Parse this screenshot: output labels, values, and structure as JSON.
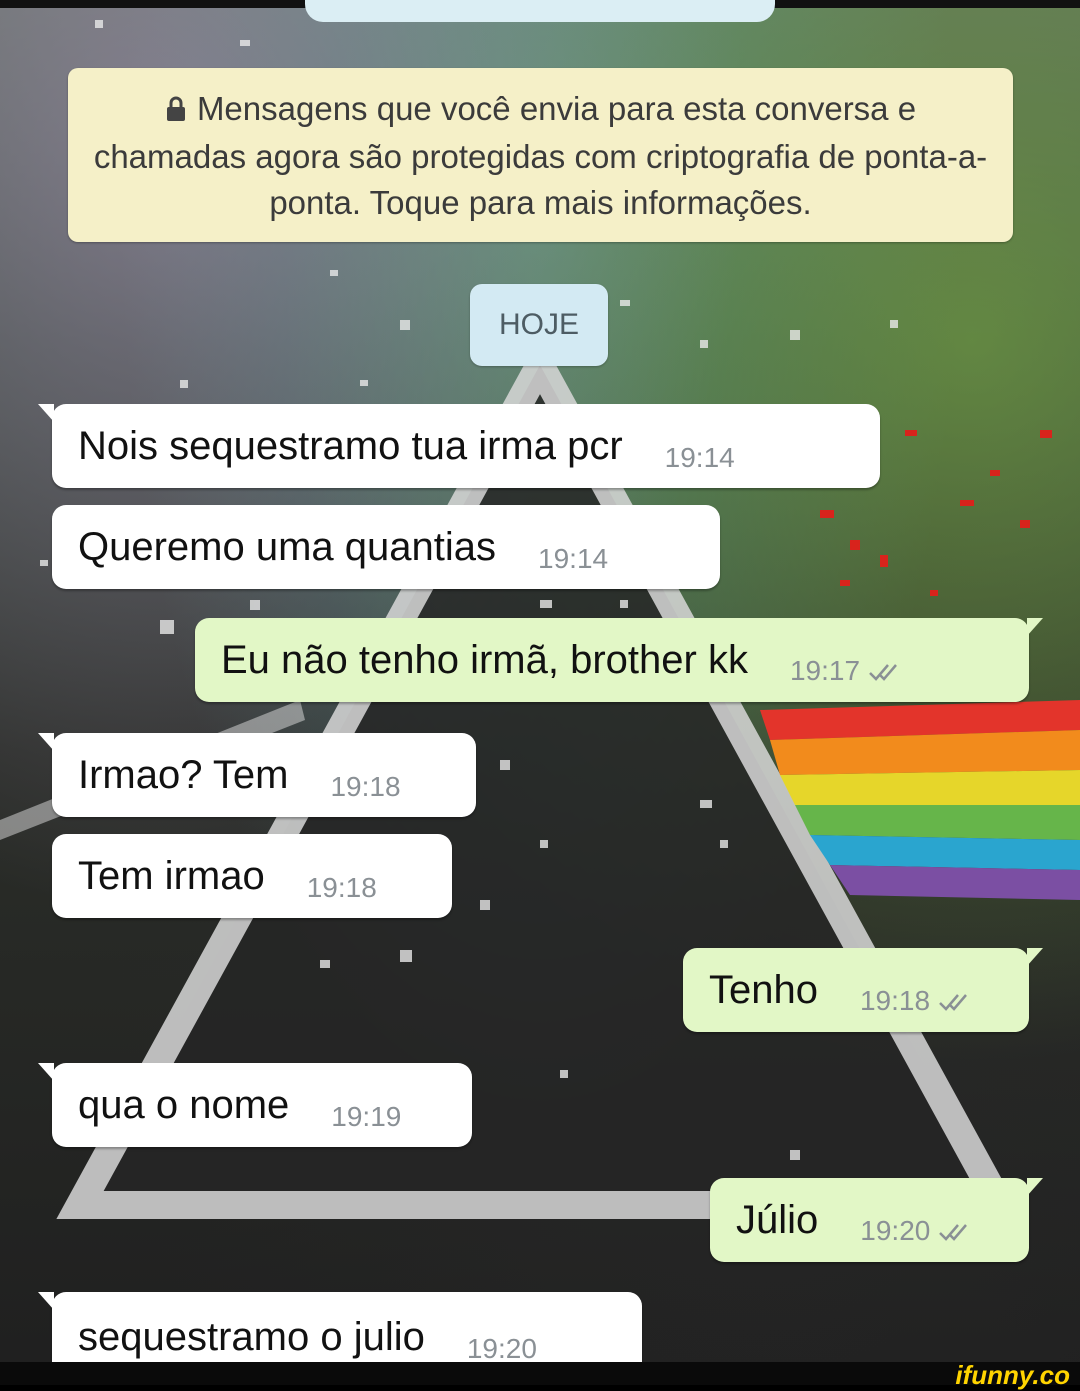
{
  "encryption_notice": "Mensagens que você envia para esta conversa e chamadas agora são protegidas com criptografia de ponta-a-ponta. Toque para mais informações.",
  "date_chip": "HOJE",
  "messages": [
    {
      "text": "Nois sequestramo tua irma pcr",
      "time": "19:14",
      "direction": "incoming"
    },
    {
      "text": "Queremo uma quantias",
      "time": "19:14",
      "direction": "incoming"
    },
    {
      "text": "Eu não tenho irmã, brother kk",
      "time": "19:17",
      "direction": "outgoing"
    },
    {
      "text": "Irmao? Tem",
      "time": "19:18",
      "direction": "incoming"
    },
    {
      "text": "Tem irmao",
      "time": "19:18",
      "direction": "incoming"
    },
    {
      "text": "Tenho",
      "time": "19:18",
      "direction": "outgoing"
    },
    {
      "text": "qua o nome",
      "time": "19:19",
      "direction": "incoming"
    },
    {
      "text": "Júlio",
      "time": "19:20",
      "direction": "outgoing"
    },
    {
      "text": "sequestramo o julio",
      "time": "19:20",
      "direction": "incoming"
    }
  ],
  "watermark": "ifunny.co",
  "icons": {
    "lock": "lock-icon",
    "read_receipt": "double-check-icon"
  },
  "colors": {
    "incoming_bubble": "#ffffff",
    "outgoing_bubble": "#e2f7c6",
    "notice_bg": "#f5f0c8",
    "date_chip_bg": "#d3eaf3",
    "ticks": "#8a9095"
  }
}
